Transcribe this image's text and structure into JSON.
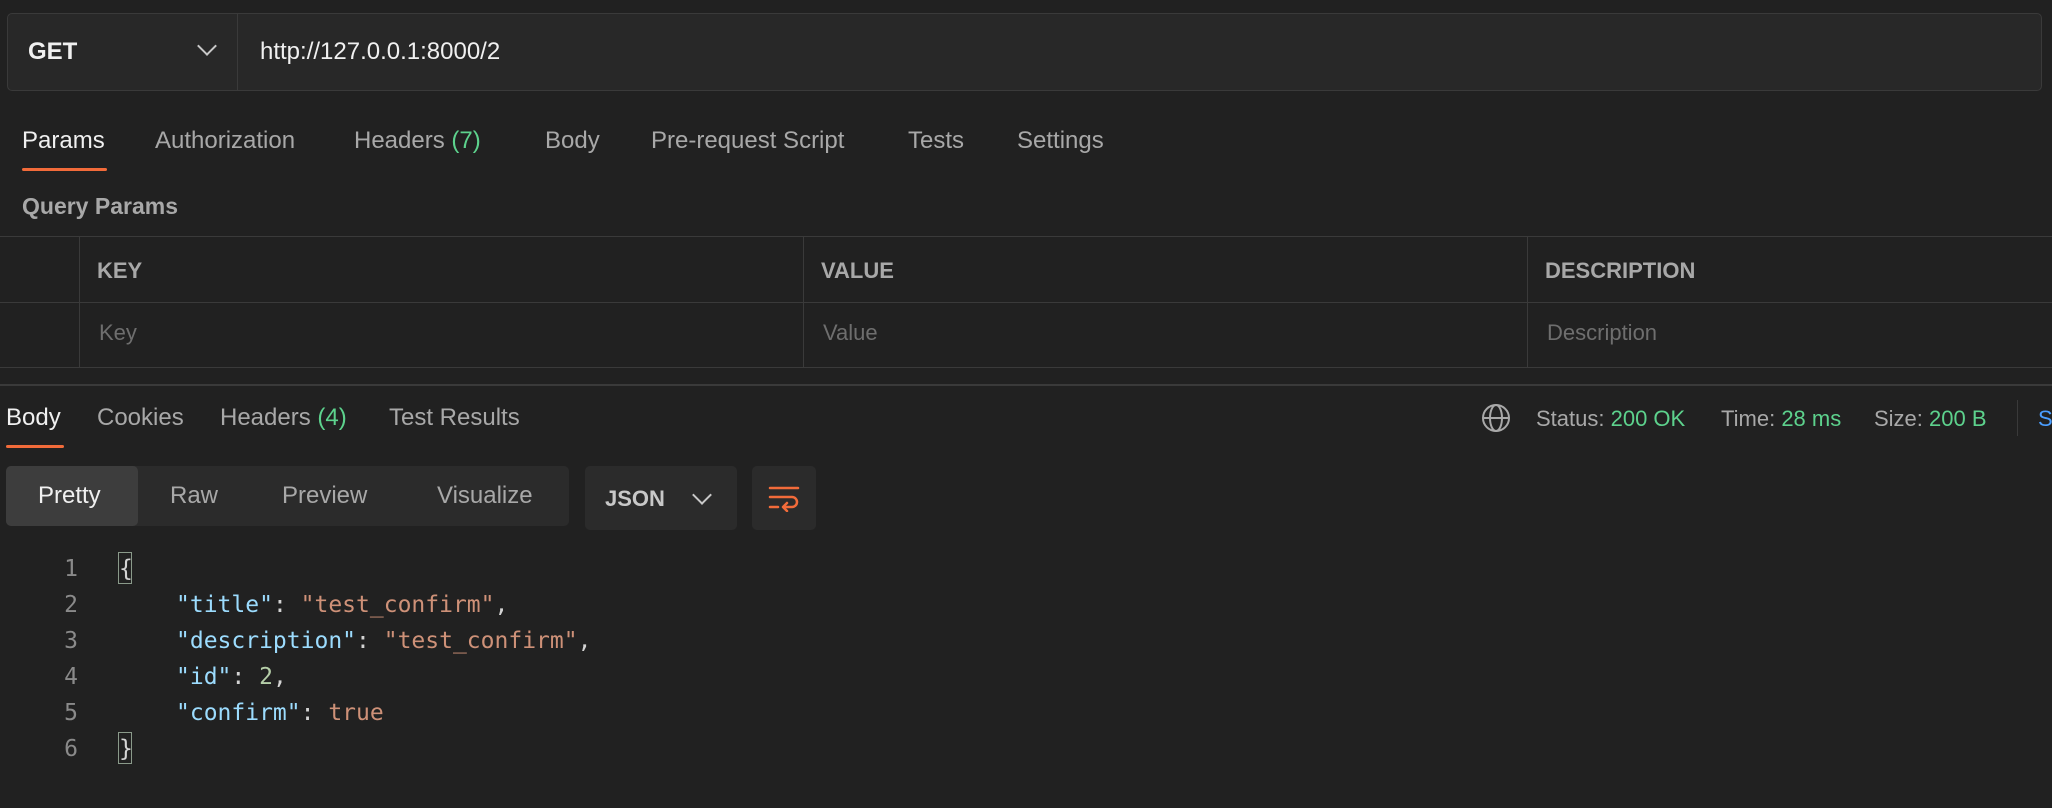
{
  "request": {
    "method": "GET",
    "url": "http://127.0.0.1:8000/2"
  },
  "request_tabs": [
    {
      "label": "Params"
    },
    {
      "label": "Authorization"
    },
    {
      "label": "Headers",
      "count": "(7)"
    },
    {
      "label": "Body"
    },
    {
      "label": "Pre-request Script"
    },
    {
      "label": "Tests"
    },
    {
      "label": "Settings"
    }
  ],
  "query_params": {
    "title": "Query Params",
    "columns": [
      "KEY",
      "VALUE",
      "DESCRIPTION"
    ],
    "placeholders": [
      "Key",
      "Value",
      "Description"
    ]
  },
  "response_tabs": [
    {
      "label": "Body"
    },
    {
      "label": "Cookies"
    },
    {
      "label": "Headers",
      "count": "(4)"
    },
    {
      "label": "Test Results"
    }
  ],
  "response_meta": {
    "status_label": "Status:",
    "status_value": "200 OK",
    "time_label": "Time:",
    "time_value": "28 ms",
    "size_label": "Size:",
    "size_value": "200 B",
    "save_partial": "S"
  },
  "format_options": [
    "Pretty",
    "Raw",
    "Preview",
    "Visualize"
  ],
  "format_selected": "Pretty",
  "language": "JSON",
  "code": {
    "line_numbers": [
      "1",
      "2",
      "3",
      "4",
      "5",
      "6"
    ],
    "open_brace": "{",
    "close_brace": "}",
    "fields": [
      {
        "key": "\"title\"",
        "value": "\"test_confirm\"",
        "kind": "str",
        "comma": ","
      },
      {
        "key": "\"description\"",
        "value": "\"test_confirm\"",
        "kind": "str",
        "comma": ","
      },
      {
        "key": "\"id\"",
        "value": "2",
        "kind": "num",
        "comma": ","
      },
      {
        "key": "\"confirm\"",
        "value": "true",
        "kind": "bool",
        "comma": ""
      }
    ]
  },
  "colors": {
    "accent": "#f26b3a",
    "success": "#5dd28d",
    "background": "#212121"
  }
}
